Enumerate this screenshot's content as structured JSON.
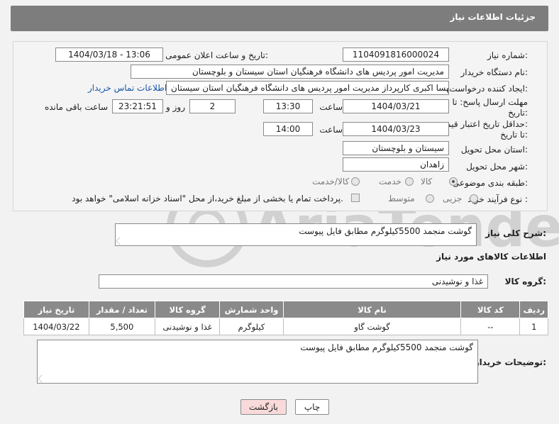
{
  "header": {
    "title": "جزئیات اطلاعات نیاز"
  },
  "form": {
    "need_number": {
      "label": "شماره نیاز:",
      "value": "1104091816000024"
    },
    "announce_datetime": {
      "label": "تاریخ و ساعت اعلان عمومی:",
      "value": "1404/03/18 - 13:06"
    },
    "buyer_org": {
      "label": "نام دستگاه خریدار:",
      "value": "مدیریت امور پردیس های دانشگاه فرهنگیان استان سیستان و بلوچستان"
    },
    "requester": {
      "label": "ایجاد کننده درخواست:",
      "value": "مهسا اکبری کارپرداز مدیریت امور پردیس های دانشگاه فرهنگیان استان سیستان",
      "contact_link": "اطلاعات تماس خریدار"
    },
    "reply_deadline": {
      "label_line1": "مهلت ارسال پاسخ: تا",
      "label_line2": "تاریخ:",
      "date": "1404/03/21",
      "time_label": "ساعت",
      "time": "13:30",
      "days": "2",
      "days_label": "روز و",
      "remaining": "23:21:51",
      "remaining_label": "ساعت باقی مانده"
    },
    "price_validity": {
      "label_line1": "حداقل تاریخ اعتبار قیمت:",
      "label_line2": "تا تاریخ:",
      "date": "1404/03/23",
      "time_label": "ساعت",
      "time": "14:00"
    },
    "delivery_province": {
      "label": "استان محل تحویل:",
      "value": "سیستان و بلوچستان"
    },
    "delivery_city": {
      "label": "شهر محل تحویل:",
      "value": "زاهدان"
    },
    "category": {
      "label": "طبقه بندی موضوعی:",
      "options": [
        "کالا",
        "خدمت",
        "کالا/خدمت"
      ],
      "selected": "کالا"
    },
    "purchase_process": {
      "label": "نوع فرآیند خرید :",
      "options": [
        "جزیی",
        "متوسط"
      ],
      "selected": "",
      "note": "پرداخت تمام یا بخشی از مبلغ خرید،از محل \"اسناد خزانه اسلامی\" خواهد بود."
    }
  },
  "description": {
    "label": "شرح کلی نیاز:",
    "value": "گوشت منجمد 5500کیلوگرم مطابق فایل پیوست"
  },
  "goods_section": {
    "title": "اطلاعات کالاهای مورد نیاز",
    "group_label": "گروه کالا:",
    "group_value": "غذا و نوشیدنی"
  },
  "items_table": {
    "headers": [
      "ردیف",
      "کد کالا",
      "نام کالا",
      "واحد شمارش",
      "گروه کالا",
      "تعداد / مقدار",
      "تاریخ نیاز"
    ],
    "rows": [
      [
        "1",
        "--",
        "گوشت گاو",
        "کیلوگرم",
        "غذا و نوشیدنی",
        "5,500",
        "1404/03/22"
      ]
    ]
  },
  "buyer_notes": {
    "label": "توضیحات خریدار:",
    "value": "گوشت منجمد 5500کیلوگرم مطابق فایل پیوست"
  },
  "buttons": {
    "print": "چاپ",
    "back": "بازگشت"
  },
  "watermark": {
    "text": "AriaTender.neT"
  },
  "colors": {
    "header_bg": "#7d7d7d",
    "link": "#1a56a8",
    "back_button_bg": "#f9dada"
  }
}
